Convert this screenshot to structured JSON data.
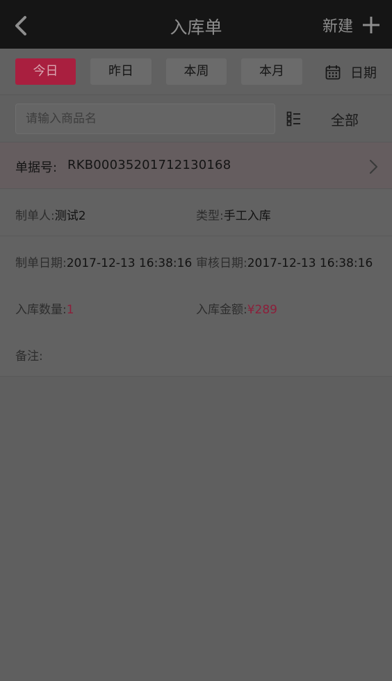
{
  "header": {
    "title": "入库单",
    "new_label": "新建",
    "back_icon": "chevron-left-icon",
    "add_icon": "plus-icon"
  },
  "filters": {
    "chips": [
      "今日",
      "昨日",
      "本周",
      "本月"
    ],
    "active_index": 0,
    "date_label": "日期",
    "date_icon": "calendar-icon"
  },
  "search": {
    "placeholder": "请输入商品名",
    "value": "",
    "list_icon": "list-icon",
    "filter_label": "全部"
  },
  "order": {
    "number_label": "单据号:",
    "number_value": "RKB00035201712130168",
    "maker_label": "制单人:",
    "maker_value": "测试2",
    "type_label": "类型:",
    "type_value": "手工入库",
    "create_date_label": "制单日期:",
    "create_date_value": "2017-12-13 16:38:16",
    "audit_date_label": "审核日期:",
    "audit_date_value": "2017-12-13 16:38:16",
    "qty_label": "入库数量:",
    "qty_value": "1",
    "amount_label": "入库金额:",
    "amount_value": "¥289",
    "remark_label": "备注:",
    "remark_value": ""
  },
  "colors": {
    "accent": "#a91f3f",
    "nav_bg": "#151515"
  }
}
